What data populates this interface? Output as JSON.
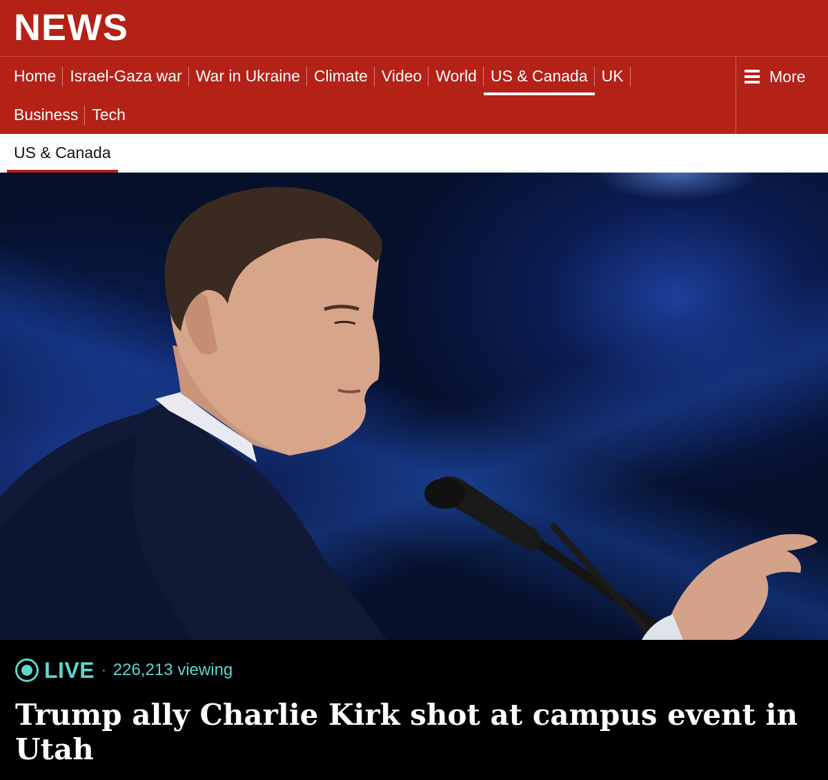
{
  "header": {
    "logo": "NEWS",
    "brand_color": "#b42117"
  },
  "nav": {
    "row1": [
      {
        "label": "Home"
      },
      {
        "label": "Israel-Gaza war"
      },
      {
        "label": "War in Ukraine"
      },
      {
        "label": "Climate"
      },
      {
        "label": "Video"
      },
      {
        "label": "World"
      },
      {
        "label": "US & Canada",
        "active": true
      },
      {
        "label": "UK"
      }
    ],
    "row2": [
      {
        "label": "Business"
      },
      {
        "label": "Tech"
      }
    ],
    "more_label": "More",
    "more_icon": "hamburger-menu-icon"
  },
  "subnav": {
    "active_label": "US & Canada"
  },
  "hero": {
    "image": "photo of speaker at microphone on stage with blue lighting"
  },
  "live": {
    "label": "LIVE",
    "separator": "·",
    "viewing": "226,213 viewing",
    "accent_color": "#5fd6cb"
  },
  "article": {
    "headline": "Trump ally Charlie Kirk shot at campus event in Utah"
  }
}
